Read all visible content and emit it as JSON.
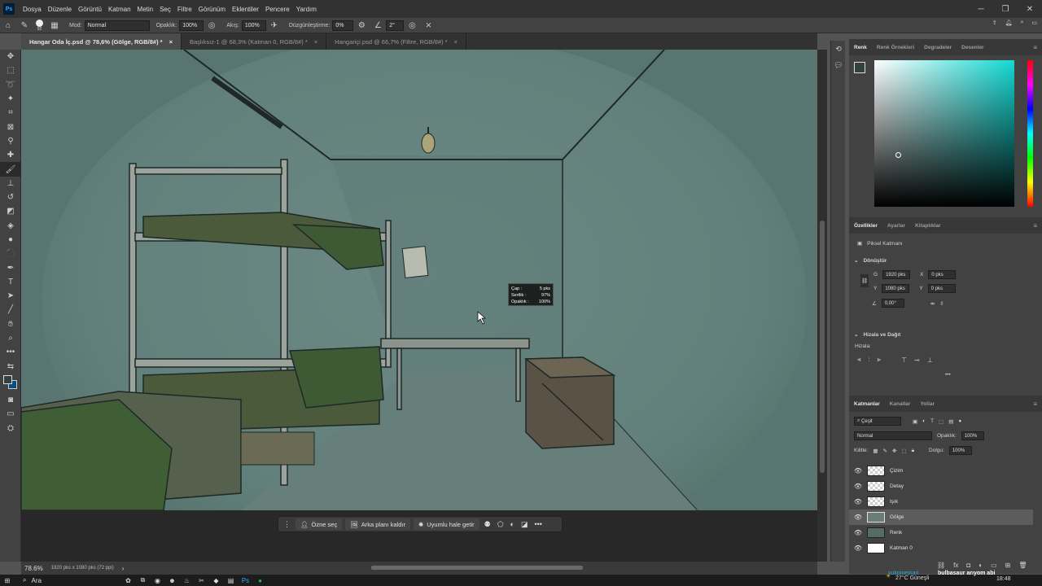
{
  "app": {
    "logo": "Ps"
  },
  "menu": [
    "Dosya",
    "Düzenle",
    "Görüntü",
    "Katman",
    "Metin",
    "Seç",
    "Filtre",
    "Görünüm",
    "Eklentiler",
    "Pencere",
    "Yardım"
  ],
  "options": {
    "brush_size": "92",
    "mode_label": "Mod:",
    "mode_value": "Normal",
    "opacity_label": "Opaklık:",
    "opacity_value": "100%",
    "flow_label": "Akış:",
    "flow_value": "100%",
    "smoothing_label": "Düzgünleştirme:",
    "smoothing_value": "0%",
    "angle_value": "2°"
  },
  "tabs": [
    {
      "label": "Hangar Oda İç.psd @ 78,6% (Gölge, RGB/8#) *",
      "close": "×"
    },
    {
      "label": "Başlıksız-1 @ 68,3% (Katman 0, RGB/8#) *",
      "close": "×"
    },
    {
      "label": "Hangariçi.psd @ 66,7% (Filtre, RGB/8#) *",
      "close": "×"
    }
  ],
  "brush_tip": {
    "cap_label": "Çap :",
    "cap_value": "5 pks",
    "hardness_label": "Sertlik :",
    "hardness_value": "97%",
    "opacity_label": "Opaklık :",
    "opacity_value": "100%"
  },
  "context_bar": {
    "select_subject": "Özne seç",
    "remove_bg": "Arka planı kaldır",
    "make_fit": "Uyumlu hale getir"
  },
  "status": {
    "zoom": "78.6%",
    "info": "1920 pks x 1080 pks (72 ppi)",
    "arrow": "›"
  },
  "color_panel": {
    "tabs": [
      "Renk",
      "Renk Örnekleri",
      "Degradeler",
      "Desenler"
    ],
    "active": 0
  },
  "properties_panel": {
    "tabs": [
      "Özellikler",
      "Ayarlar",
      "Kitaplıklar"
    ],
    "layer_type": "Piksel Katmanı",
    "transform_title": "Dönüştür",
    "w_label": "G",
    "w_value": "1920 pks",
    "h_label": "Y",
    "h_value": "1080 pks",
    "x_label": "X",
    "x_value": "0 pks",
    "y_label": "Y",
    "y_value": "0 pks",
    "angle_value": "0,00°",
    "align_title": "Hizala ve Dağıt",
    "align_label": "Hizala:",
    "more": "•••"
  },
  "layers_panel": {
    "tabs": [
      "Katmanlar",
      "Kanallar",
      "Yollar"
    ],
    "filter_label": "Çeşit",
    "blend": "Normal",
    "opacity_label": "Opaklık:",
    "opacity_value": "100%",
    "lock_label": "Kilitle:",
    "fill_label": "Dolgu:",
    "fill_value": "100%",
    "layers": [
      {
        "name": "Çizim"
      },
      {
        "name": "Detay"
      },
      {
        "name": "Işık"
      },
      {
        "name": "Gölge"
      },
      {
        "name": "Renk"
      },
      {
        "name": "Katman 0"
      }
    ],
    "selected": "Gölge"
  },
  "taskbar": {
    "search": "Ara",
    "weather": "27°C Güneşli",
    "time": "18:48",
    "overlay_user": "yukpinejnari",
    "overlay_text": "bulbasaur arıyom abi"
  },
  "colors": {
    "ps_blue": "#31a8ff",
    "wall": "#5e7c78",
    "selected_layer": "#5c5c5c"
  }
}
